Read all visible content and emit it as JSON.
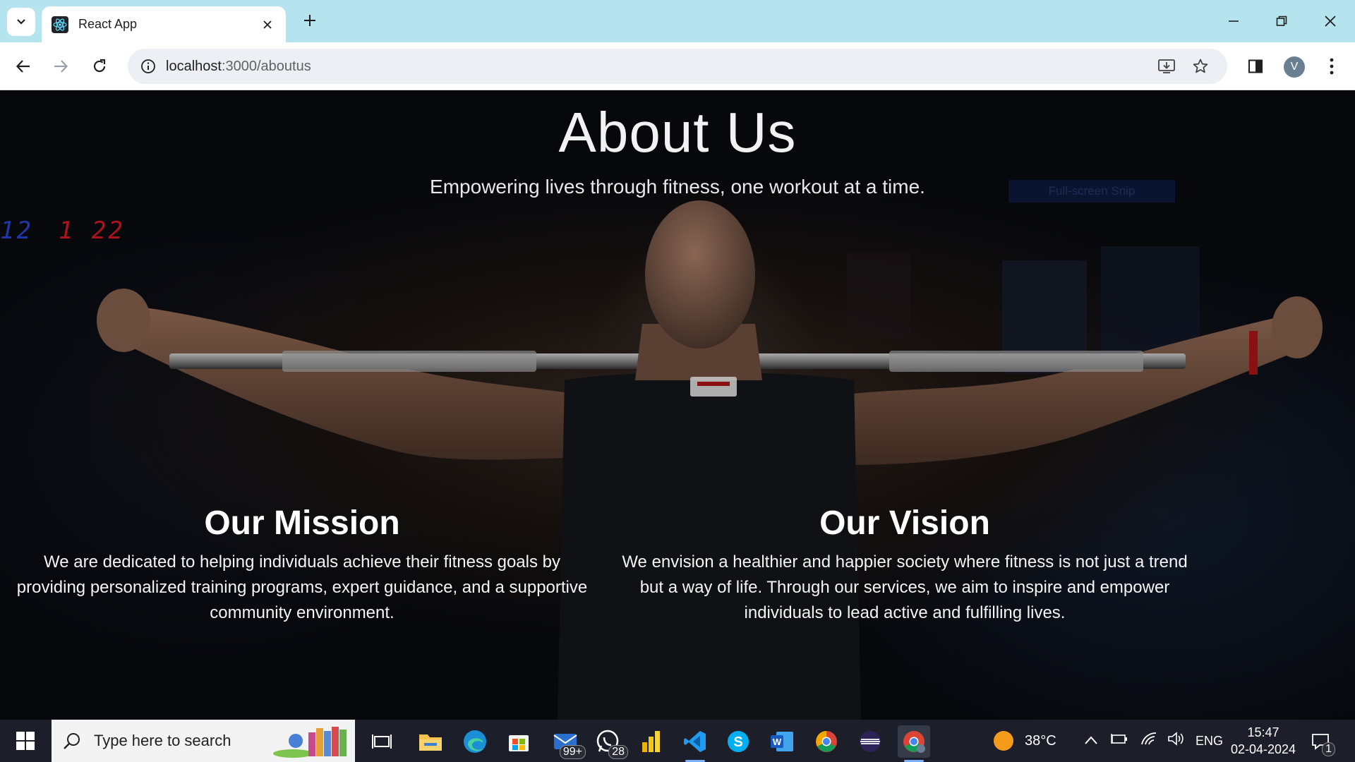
{
  "browser": {
    "tab_title": "React App",
    "url_host": "localhost",
    "url_path": ":3000/aboutus",
    "profile_initial": "V"
  },
  "page": {
    "title": "About Us",
    "tagline": "Empowering lives through fitness, one workout at a time.",
    "snip_label": "Full-screen Snip",
    "clock_blue": "12",
    "clock_red": "1 22",
    "mission": {
      "heading": "Our Mission",
      "text": "We are dedicated to helping individuals achieve their fitness goals by providing personalized training programs, expert guidance, and a supportive community environment."
    },
    "vision": {
      "heading": "Our Vision",
      "text": "We envision a healthier and happier society where fitness is not just a trend but a way of life. Through our services, we aim to inspire and empower individuals to lead active and fulfilling lives."
    }
  },
  "taskbar": {
    "search_placeholder": "Type here to search",
    "mail_badge": "99+",
    "whatsapp_badge": "28",
    "weather": "38°C",
    "language": "ENG",
    "time": "15:47",
    "date": "02-04-2024",
    "notification_count": "1"
  },
  "colors": {
    "tabbar": "#b5e3ee",
    "taskbar": "#1c1f29",
    "page_text": "#ffffff"
  }
}
